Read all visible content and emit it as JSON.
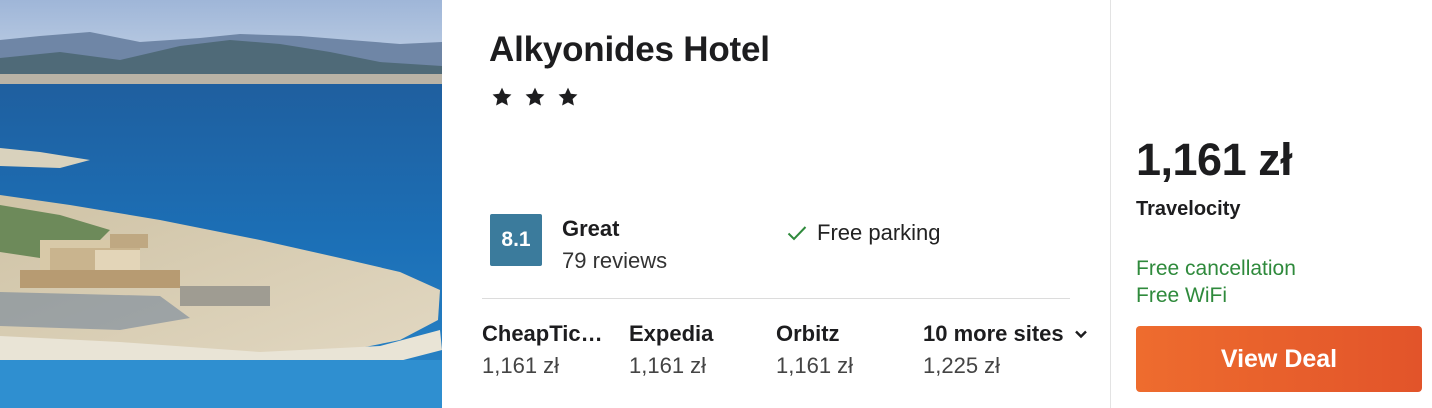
{
  "hotel": {
    "name": "Alkyonides Hotel",
    "star_rating": 3
  },
  "rating": {
    "score": "8.1",
    "label": "Great",
    "reviews": "79 reviews"
  },
  "amenities": [
    {
      "label": "Free parking",
      "icon": "checkmark-icon"
    }
  ],
  "sites": [
    {
      "name": "CheapTic…",
      "price": "1,161 zł"
    },
    {
      "name": "Expedia",
      "price": "1,161 zł"
    },
    {
      "name": "Orbitz",
      "price": "1,161 zł"
    }
  ],
  "more_sites": {
    "label": "10 more sites",
    "price": "1,225 zł",
    "icon": "chevron-down-icon"
  },
  "deal": {
    "price": "1,161 zł",
    "provider": "Travelocity",
    "perks": [
      "Free cancellation",
      "Free WiFi"
    ],
    "button_label": "View Deal"
  },
  "colors": {
    "score_badge": "#3b7b9c",
    "perk_text": "#2f8a3c",
    "cta_start": "#ee6c2e",
    "cta_end": "#e2542a"
  }
}
